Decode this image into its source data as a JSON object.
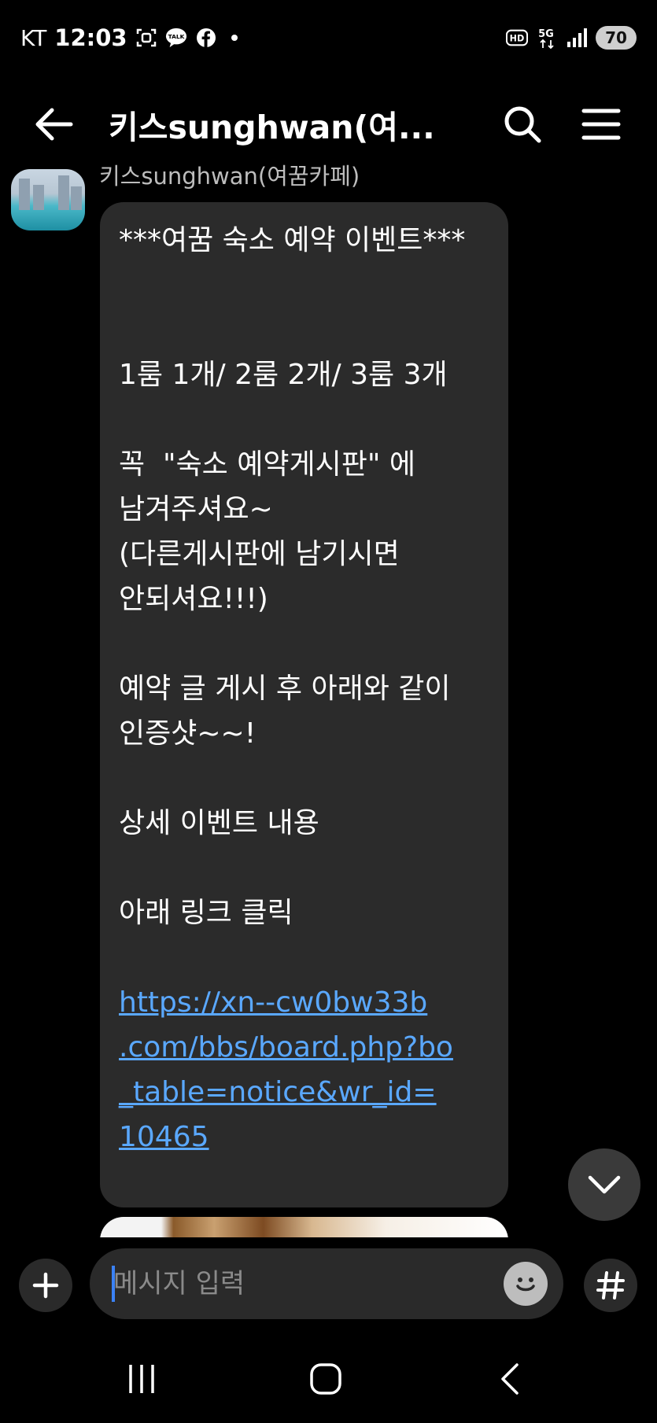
{
  "status_bar": {
    "carrier": "KT",
    "time": "12:03",
    "battery": "70",
    "icons": [
      "screenshot-icon",
      "kakaotalk-icon",
      "facebook-icon",
      "hd-icon",
      "5g-icon",
      "signal-icon"
    ]
  },
  "header": {
    "title": "키스sunghwan(여..."
  },
  "chat": {
    "sender_name": "키스sunghwan(여꿈카페)",
    "message_lines": [
      "***여꿈 숙소 예약 이벤트***",
      "",
      "",
      "1룸 1개/ 2룸 2개/ 3룸 3개",
      "",
      "꼭  \"숙소 예약게시판\" 에",
      "남겨주셔요~",
      "(다른게시판에 남기시면",
      "안되셔요!!!)",
      "",
      "예약 글 게시 후 아래와 같이",
      "인증샷~~!",
      "",
      "상세 이벤트 내용",
      "",
      "아래 링크 클릭",
      ""
    ],
    "link_lines": [
      "https://xn--cw0bw33b",
      ".com/bbs/board.php?bo",
      "_table=notice&wr_id=",
      "10465"
    ]
  },
  "input": {
    "placeholder": "메시지 입력"
  },
  "colors": {
    "background": "#000000",
    "bubble": "#2b2b2b",
    "link": "#5aa8ff",
    "caret": "#3b82f6"
  }
}
